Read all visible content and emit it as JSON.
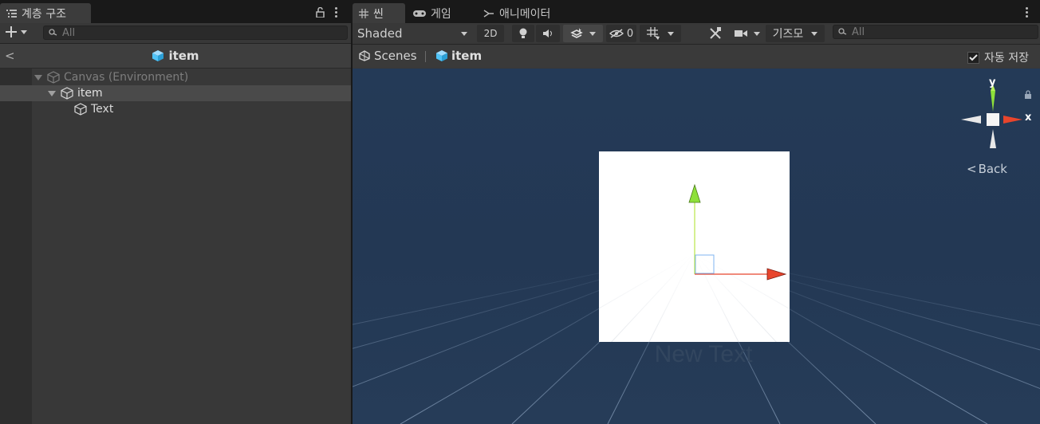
{
  "hierarchy": {
    "tab_label": "계층 구조",
    "search_placeholder": "All",
    "breadcrumb": "item",
    "rows": [
      {
        "label": "Canvas (Environment)"
      },
      {
        "label": "item"
      },
      {
        "label": "Text"
      }
    ]
  },
  "scene": {
    "tabs": [
      {
        "label": "씬",
        "icon": "grid-icon"
      },
      {
        "label": "게임",
        "icon": "gamepad-icon"
      },
      {
        "label": "애니메이터",
        "icon": "animator-icon"
      }
    ],
    "shading_mode": "Shaded",
    "mode_2d": "2D",
    "hidden_count": "0",
    "gizmos_label": "기즈모",
    "search_placeholder": "All",
    "breadcrumb_scenes": "Scenes",
    "breadcrumb_item": "item",
    "auto_save_label": "자동 저장",
    "auto_save_checked": true,
    "orientation": {
      "axis_y": "y",
      "axis_x": "x",
      "view_label": "Back"
    },
    "canvas_text": "New Text"
  },
  "colors": {
    "accent_blue": "#4fc3f7",
    "axis_red": "#e8452c",
    "axis_green": "#8ee03a",
    "sky": "#243a57"
  }
}
